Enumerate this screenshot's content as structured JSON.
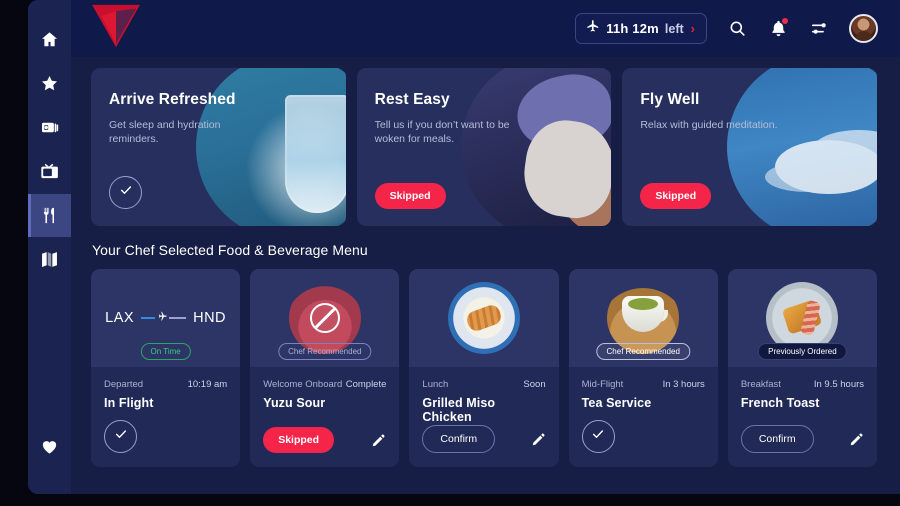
{
  "header": {
    "logo_name": "delta-widget-logo",
    "flight_status": {
      "time": "11h 12m",
      "label": "left",
      "chevron": "›",
      "plane_icon": "airplane-icon"
    },
    "icons": {
      "search": "search-icon",
      "notifications": "bell-icon",
      "settings": "sliders-icon",
      "avatar": "user-avatar"
    }
  },
  "sidebar": {
    "items": [
      {
        "name": "home",
        "icon": "home-icon",
        "active": false
      },
      {
        "name": "favorites",
        "icon": "star-icon",
        "active": false
      },
      {
        "name": "wallet",
        "icon": "wallet-icon",
        "active": false
      },
      {
        "name": "entertainment",
        "icon": "tv-icon",
        "active": false
      },
      {
        "name": "dining",
        "icon": "fork-knife-icon",
        "active": true
      },
      {
        "name": "map",
        "icon": "map-icon",
        "active": false
      }
    ],
    "bottom": {
      "name": "wellness",
      "icon": "heart-icon"
    }
  },
  "promos": [
    {
      "title": "Arrive Refreshed",
      "subtitle": "Get sleep and hydration reminders.",
      "action_type": "check",
      "action_label": "",
      "art": "water-glass-image"
    },
    {
      "title": "Rest Easy",
      "subtitle": "Tell us if you don’t want to be woken for meals.",
      "action_type": "pill",
      "action_label": "Skipped",
      "art": "sleeping-passenger-image"
    },
    {
      "title": "Fly Well",
      "subtitle": "Relax with guided meditation.",
      "action_type": "pill",
      "action_label": "Skipped",
      "art": "sky-clouds-image"
    }
  ],
  "menu": {
    "section_title": "Your Chef Selected Food & Beverage Menu",
    "flight_card": {
      "origin": "LAX",
      "destination": "HND",
      "status_chip": "On Time",
      "meta_label": "Departed",
      "meta_value": "10:19 am",
      "title": "In Flight",
      "action_type": "check"
    },
    "items": [
      {
        "art": "cocktail-image",
        "chip": "Chef Recommended",
        "chip_style": "ghost",
        "meta_label": "Welcome Onboard",
        "meta_value": "Complete",
        "title": "Yuzu Sour",
        "action_type": "pill",
        "action_label": "Skipped",
        "has_edit": true
      },
      {
        "art": "grilled-chicken-image",
        "chip": "",
        "chip_style": "none",
        "meta_label": "Lunch",
        "meta_value": "Soon",
        "title": "Grilled Miso Chicken",
        "action_type": "outline",
        "action_label": "Confirm",
        "has_edit": true
      },
      {
        "art": "tea-cup-image",
        "chip": "Chef Recommended",
        "chip_style": "light",
        "meta_label": "Mid-Flight",
        "meta_value": "In 3 hours",
        "title": "Tea Service",
        "action_type": "check",
        "action_label": "",
        "has_edit": false
      },
      {
        "art": "french-toast-image",
        "chip": "Previously Ordered",
        "chip_style": "dark",
        "meta_label": "Breakfast",
        "meta_value": "In 9.5 hours",
        "title": "French Toast",
        "action_type": "outline",
        "action_label": "Confirm",
        "has_edit": true
      }
    ]
  },
  "colors": {
    "accent_red": "#f5254a",
    "brand_red": "#e8213e",
    "on_time_green": "#3dcc85",
    "app_bg": "#161e45",
    "sidebar_bg": "#1b2350",
    "card_bg": "#262f5e"
  }
}
